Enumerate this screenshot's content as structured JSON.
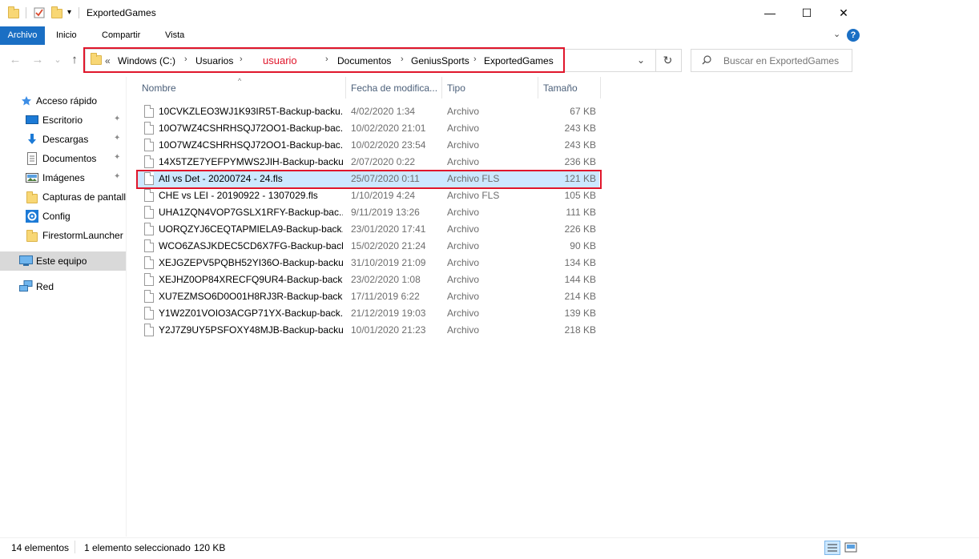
{
  "window": {
    "title": "ExportedGames",
    "minimize": "—",
    "maximize": "☐",
    "close": "✕"
  },
  "ribbon": {
    "tabs": [
      "Archivo",
      "Inicio",
      "Compartir",
      "Vista"
    ],
    "expand": "⌄",
    "help": "?"
  },
  "address": {
    "overflow": "«",
    "crumbs": [
      "Windows (C:)",
      "Usuarios",
      "usuario",
      "Documentos",
      "GeniusSports",
      "ExportedGames"
    ],
    "highlight_color": "#e0162b",
    "user_crumb_color": "#e0162b"
  },
  "search": {
    "placeholder": "Buscar en ExportedGames"
  },
  "nav": {
    "back": "←",
    "forward": "→",
    "recent": "⌄",
    "up": "↑",
    "dropdown": "⌄",
    "refresh": "↻"
  },
  "sidebar": {
    "items": [
      {
        "label": "Acceso rápido",
        "icon": "star-icon"
      },
      {
        "label": "Escritorio",
        "icon": "desktop-icon",
        "pinned": true
      },
      {
        "label": "Descargas",
        "icon": "download-icon",
        "pinned": true
      },
      {
        "label": "Documentos",
        "icon": "document-icon",
        "pinned": true
      },
      {
        "label": "Imágenes",
        "icon": "image-icon",
        "pinned": true
      },
      {
        "label": "Capturas de pantall",
        "icon": "folder-icon"
      },
      {
        "label": "Config",
        "icon": "gear-icon"
      },
      {
        "label": "FirestormLauncher",
        "icon": "folder-icon"
      },
      {
        "label": "Este equipo",
        "icon": "computer-icon"
      },
      {
        "label": "Red",
        "icon": "network-icon"
      }
    ],
    "pin_glyph": "📌"
  },
  "columns": {
    "name": "Nombre",
    "date": "Fecha de modifica...",
    "type": "Tipo",
    "size": "Tamaño",
    "sort_glyph": "^"
  },
  "files": [
    {
      "name": "10CVKZLEO3WJ1K93IR5T-Backup-backu...",
      "date": "4/02/2020 1:34",
      "type": "Archivo",
      "size": "67 KB"
    },
    {
      "name": "10O7WZ4CSHRHSQJ72OO1-Backup-bac...",
      "date": "10/02/2020 21:01",
      "type": "Archivo",
      "size": "243 KB"
    },
    {
      "name": "10O7WZ4CSHRHSQJ72OO1-Backup-bac...",
      "date": "10/02/2020 23:54",
      "type": "Archivo",
      "size": "243 KB"
    },
    {
      "name": "14X5TZE7YEFPYMWS2JIH-Backup-backu...",
      "date": "2/07/2020 0:22",
      "type": "Archivo",
      "size": "236 KB"
    },
    {
      "name": "Atl vs Det - 20200724 - 24.fls",
      "date": "25/07/2020 0:11",
      "type": "Archivo FLS",
      "size": "121 KB",
      "selected": true
    },
    {
      "name": "CHE vs LEI - 20190922 - 1307029.fls",
      "date": "1/10/2019 4:24",
      "type": "Archivo FLS",
      "size": "105 KB"
    },
    {
      "name": "UHA1ZQN4VOP7GSLX1RFY-Backup-bac...",
      "date": "9/11/2019 13:26",
      "type": "Archivo",
      "size": "111 KB"
    },
    {
      "name": "UORQZYJ6CEQTAPMIELA9-Backup-back...",
      "date": "23/01/2020 17:41",
      "type": "Archivo",
      "size": "226 KB"
    },
    {
      "name": "WCO6ZASJKDEC5CD6X7FG-Backup-back...",
      "date": "15/02/2020 21:24",
      "type": "Archivo",
      "size": "90 KB"
    },
    {
      "name": "XEJGZEPV5PQBH52YI36O-Backup-backu...",
      "date": "31/10/2019 21:09",
      "type": "Archivo",
      "size": "134 KB"
    },
    {
      "name": "XEJHZ0OP84XRECFQ9UR4-Backup-back...",
      "date": "23/02/2020 1:08",
      "type": "Archivo",
      "size": "144 KB"
    },
    {
      "name": "XU7EZMSO6D0O01H8RJ3R-Backup-backu...",
      "date": "17/11/2019 6:22",
      "type": "Archivo",
      "size": "214 KB"
    },
    {
      "name": "Y1W2Z01VOIO3ACGP71YX-Backup-back...",
      "date": "21/12/2019 19:03",
      "type": "Archivo",
      "size": "139 KB"
    },
    {
      "name": "Y2J7Z9UY5PSFOXY48MJB-Backup-backu...",
      "date": "10/01/2020 21:23",
      "type": "Archivo",
      "size": "218 KB"
    }
  ],
  "status": {
    "count": "14 elementos",
    "selection": "1 elemento seleccionado",
    "size": "120 KB"
  },
  "colors": {
    "accent": "#1a6fc4",
    "selection": "#cce8ff",
    "highlight": "#e0162b"
  }
}
